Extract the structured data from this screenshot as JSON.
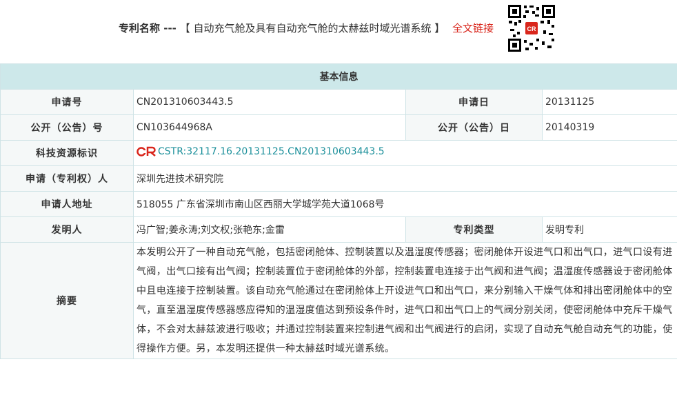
{
  "header": {
    "title_label": "专利名称 ---",
    "title_text": "【 自动充气舱及具有自动充气舱的太赫兹时域光谱系统 】",
    "fulltext_link": "全文链接",
    "qr_badge": "CR"
  },
  "section_title": "基本信息",
  "fields": {
    "app_no_label": "申请号",
    "app_no": "CN201310603443.5",
    "app_date_label": "申请日",
    "app_date": "20131125",
    "pub_no_label": "公开（公告）号",
    "pub_no": "CN103644968A",
    "pub_date_label": "公开（公告）日",
    "pub_date": "20140319",
    "cstr_label": "科技资源标识",
    "cstr_value": "CSTR:32117.16.20131125.CN201310603443.5",
    "applicant_label": "申请（专利权）人",
    "applicant": "深圳先进技术研究院",
    "address_label": "申请人地址",
    "address": "518055 广东省深圳市南山区西丽大学城学苑大道1068号",
    "inventor_label": "发明人",
    "inventors": "冯广智;姜永涛;刘文权;张艳东;金雷",
    "type_label": "专利类型",
    "type": "发明专利",
    "abstract_label": "摘要",
    "abstract": "本发明公开了一种自动充气舱，包括密闭舱体、控制装置以及温湿度传感器；密闭舱体开设进气口和出气口，进气口设有进气阀，出气口接有出气阀；控制装置位于密闭舱体的外部，控制装置电连接于出气阀和进气阀；温湿度传感器设于密闭舱体中且电连接于控制装置。该自动充气舱通过在密闭舱体上开设进气口和出气口，来分别输入干燥气体和排出密闭舱体中的空气，直至温湿度传感器感应得知的温湿度值达到预设条件时，进气口和出气口上的气阀分别关闭，使密闭舱体中充斥干燥气体，不会对太赫兹波进行吸收；并通过控制装置来控制进气阀和出气阀进行的启闭，实现了自动充气舱自动充气的功能，使得操作方便。另，本发明还提供一种太赫兹时域光谱系统。"
  },
  "colors": {
    "label": "#a0521b",
    "section_bg": "#cde8ea",
    "link": "#d9261c",
    "cstr": "#1a8f9a"
  }
}
